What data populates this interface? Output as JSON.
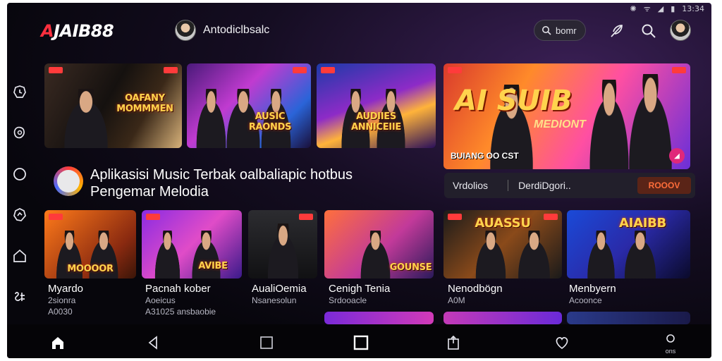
{
  "status": {
    "icons": [
      "settings-icon",
      "wifi-icon",
      "signal-icon",
      "battery-icon"
    ],
    "time": "13:34"
  },
  "header": {
    "logo_a": "A",
    "logo_rest": "JAIB88",
    "profile_name": "Antodiclbsalc",
    "search_label": "bomr"
  },
  "hero_tiles": [
    {
      "caption": "OAFANY\nMOMMMEN"
    },
    {
      "caption": "AUSIC\nRAONDS"
    },
    {
      "caption": "AUDIIES\nANNICEIIE"
    }
  ],
  "feature": {
    "title": "AI SUIB",
    "subtitle": "MEDIONT",
    "footer": "BUIANG OO CST"
  },
  "section": {
    "title_line1": "Aplikasisi Music Terbak oalbaliapic hotbus",
    "title_line2": "Pengemar Melodia"
  },
  "tabs": {
    "tab1": "Vrdolios",
    "tab2": "DerdiDgori..",
    "badge": "ROOOV"
  },
  "row": [
    {
      "poster": "MOOOOR",
      "title": "Myardo",
      "sub1": "2sionra",
      "sub2": "A0030"
    },
    {
      "poster": "AVIBE",
      "title": "Pacnah kober",
      "sub1": "Aoeicus",
      "sub2": "A31025 ansbaobie"
    },
    {
      "poster": "",
      "title": "AualiOemia",
      "sub1": "Nsanesolun",
      "sub2": ""
    },
    {
      "poster": "GOUNSE",
      "title": "Cenigh Tenia",
      "sub1": "Srdooacle",
      "sub2": ""
    },
    {
      "poster": "AUASSU",
      "title": "Nenodbögn",
      "sub1": "A0M",
      "sub2": ""
    },
    {
      "poster": "AIAIBB",
      "title": "Menbyern",
      "sub1": "Acoonce",
      "sub2": ""
    }
  ],
  "bottom_nav": {
    "settings_label": "ons"
  },
  "colors": {
    "brand_red": "#ff2f3e",
    "accent_orange": "#ff6d3a"
  }
}
